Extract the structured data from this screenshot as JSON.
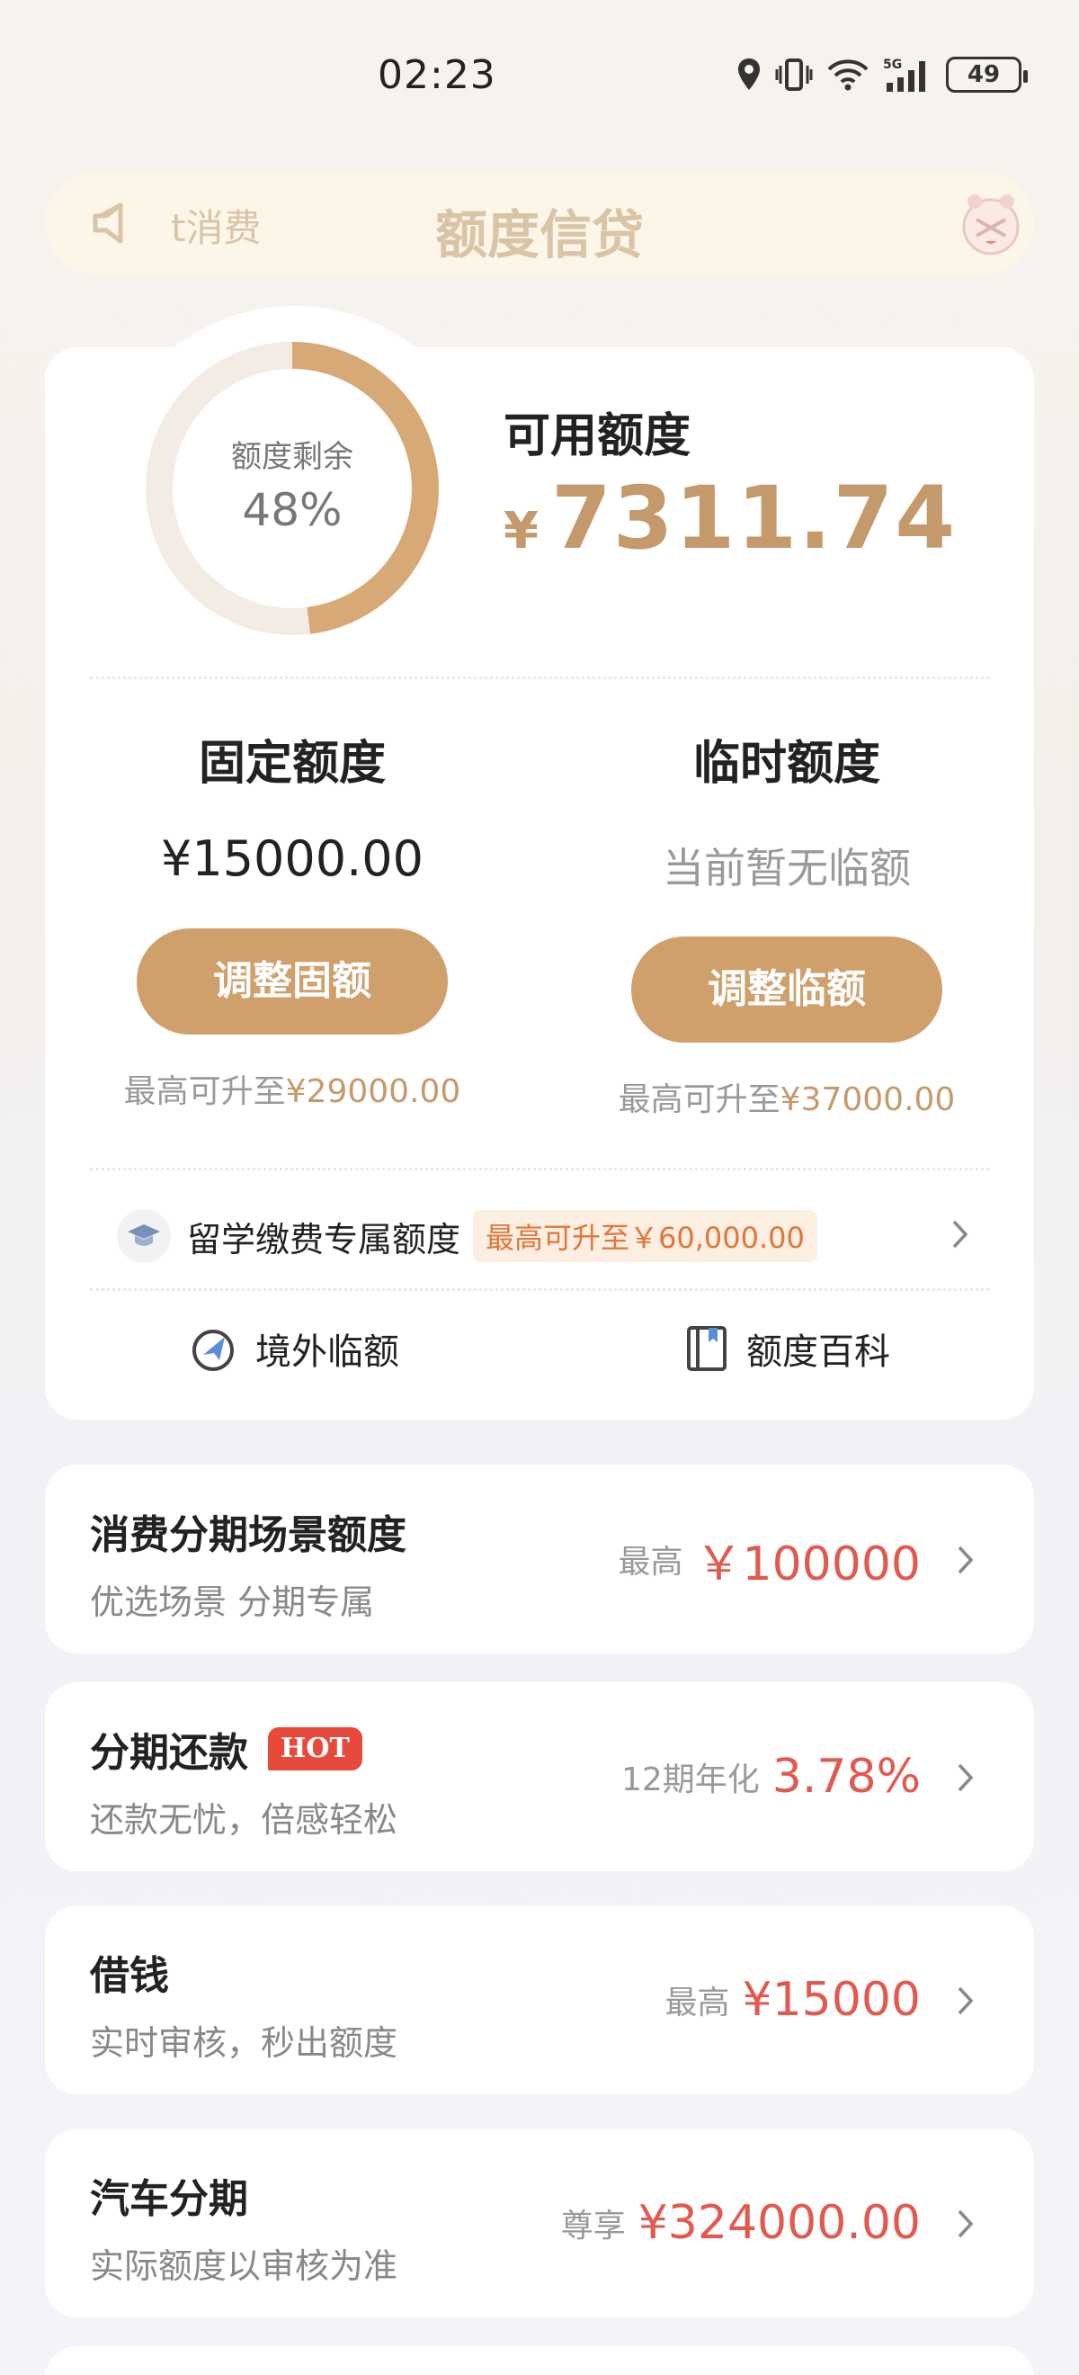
{
  "status_bar": {
    "time": "02:23",
    "battery": "49",
    "network": "5G"
  },
  "nav": {
    "ticker": "t消费",
    "title": "额度信贷"
  },
  "credit": {
    "ring_label": "额度剩余",
    "ring_percent_text": "48%",
    "ring_fraction": 0.48,
    "available_label": "可用额度",
    "available_currency": "¥",
    "available_amount": "7311.74"
  },
  "fixed": {
    "title": "固定额度",
    "value": "¥15000.00",
    "button": "调整固额",
    "hint_prefix": "最高可升至",
    "hint_amount": "¥29000.00"
  },
  "temp": {
    "title": "临时额度",
    "value": "当前暂无临额",
    "button": "调整临额",
    "hint_prefix": "最高可升至",
    "hint_amount": "¥37000.00"
  },
  "study": {
    "label": "留学缴费专属额度",
    "tag": "最高可升至￥60,000.00"
  },
  "quick_links": {
    "overseas": "境外临额",
    "wiki": "额度百科"
  },
  "list": [
    {
      "title": "消费分期场景额度",
      "subtitle": "优选场景 分期专属",
      "prefix": "最高",
      "value": "￥100000"
    },
    {
      "title": "分期还款",
      "badge": "HOT",
      "subtitle": "还款无忧，倍感轻松",
      "prefix": "12期年化",
      "value": "3.78%"
    },
    {
      "title": "借钱",
      "subtitle": "实时审核，秒出额度",
      "prefix": "最高",
      "value": "¥15000"
    },
    {
      "title": "汽车分期",
      "subtitle": "实际额度以审核为准",
      "prefix": "尊享",
      "value": "¥324000.00"
    }
  ],
  "colors": {
    "gold": "#c49a6c",
    "button": "#cfa06c",
    "red": "#e05a4f",
    "ring_track": "#f3ece4"
  }
}
